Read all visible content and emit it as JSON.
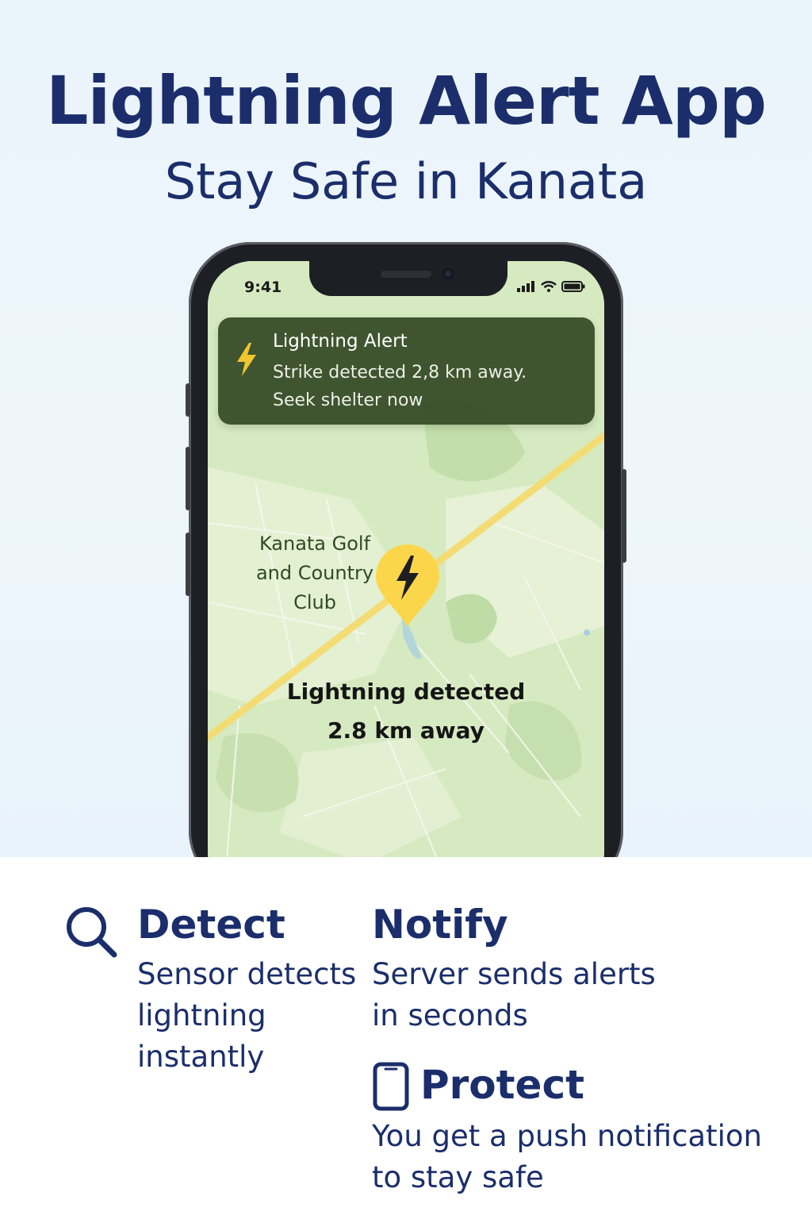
{
  "header": {
    "title": "Lightning Alert App",
    "subtitle": "Stay Safe in Kanata"
  },
  "phone": {
    "status_bar": {
      "time": "9:41",
      "icons": [
        "cellular-signal-icon",
        "wifi-icon",
        "battery-icon"
      ]
    },
    "notification": {
      "icon": "lightning-bolt-icon",
      "title": "Lightning Alert",
      "body_line1": "Strike detected 2,8 km away.",
      "body_line2": "Seek shelter now"
    },
    "map": {
      "place_label_lines": [
        "Kanata Golf",
        "and Country",
        "Club"
      ],
      "pin_icon": "lightning-pin-icon",
      "detection_line1": "Lightning detected",
      "detection_line2": "2.8 km away"
    }
  },
  "features": [
    {
      "icon": "search-icon",
      "title": "Detect",
      "desc_lines": [
        "Sensor detects",
        "lightning",
        "instantly"
      ]
    },
    {
      "icon": "",
      "title": "Notify",
      "desc_lines": [
        "Server sends alerts",
        "in seconds"
      ]
    },
    {
      "icon": "phone-icon",
      "title": "Protect",
      "desc_lines": [
        "You get a push notification",
        "to stay safe"
      ]
    }
  ],
  "colors": {
    "brand_navy": "#1b2e6b",
    "notification_bg": "#384e2a",
    "pin_yellow": "#fcd64a",
    "map_green": "#d8ebc4",
    "road_yellow": "#f3dc74"
  }
}
